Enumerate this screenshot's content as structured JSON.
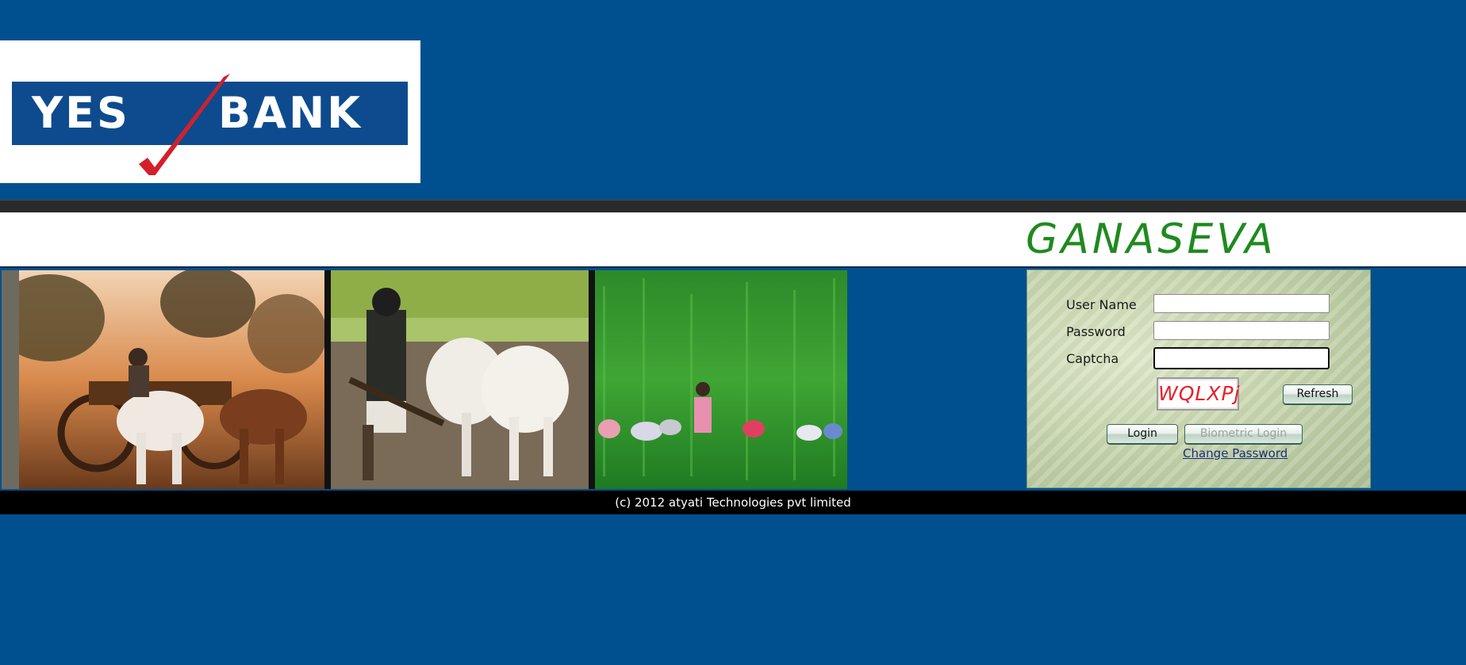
{
  "brand": {
    "logo_left": "YES",
    "logo_right": "BANK",
    "brand_blue": "#0e4b8e",
    "check_red": "#d3202a"
  },
  "app": {
    "title": "GANASEVA",
    "title_color": "#1f8a1f"
  },
  "login": {
    "username_label": "User Name",
    "username_value": "",
    "password_label": "Password",
    "password_value": "",
    "captcha_label": "Captcha",
    "captcha_value": "",
    "captcha_code": "WQLXPj",
    "refresh_label": "Refresh",
    "login_label": "Login",
    "biometric_label": "Biometric Login",
    "change_password_label": "Change Password"
  },
  "photos": [
    {
      "name": "bullock-cart"
    },
    {
      "name": "ploughing-oxen"
    },
    {
      "name": "rice-field-workers"
    }
  ],
  "footer": {
    "copyright": "(c) 2012 atyati Technologies pvt limited"
  },
  "colors": {
    "page_background": "#00508f",
    "footer_background": "#000000"
  }
}
